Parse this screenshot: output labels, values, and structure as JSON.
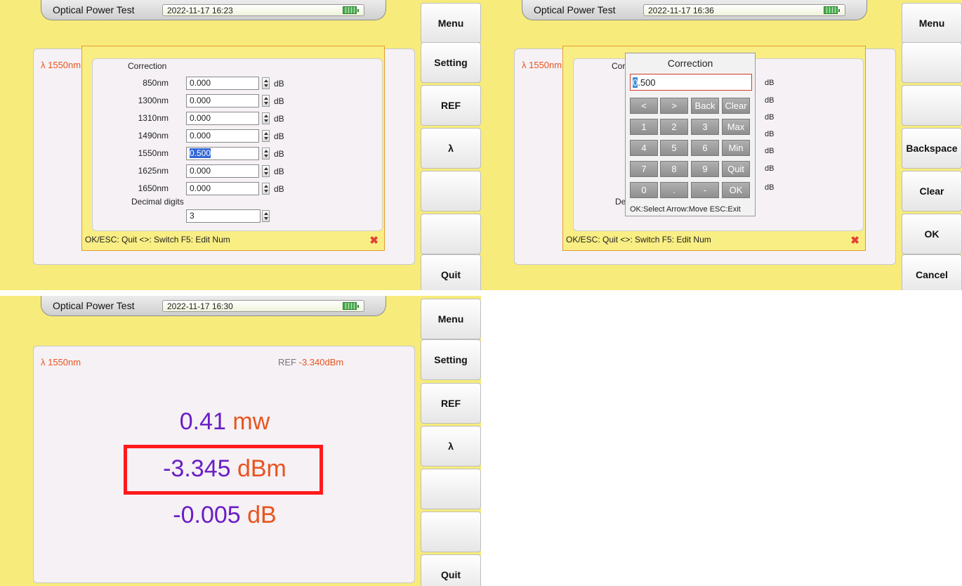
{
  "panel_correction": {
    "title": "Optical Power Test",
    "datetime": "2022-11-17 16:23",
    "wavelength": "λ 1550nm",
    "softkeys": [
      "Menu",
      "Setting",
      "REF",
      "λ",
      "",
      "",
      "Quit"
    ],
    "dialog": {
      "heading": "Correction",
      "rows": [
        {
          "label": "850nm",
          "value": "0.000",
          "unit": "dB"
        },
        {
          "label": "1300nm",
          "value": "0.000",
          "unit": "dB"
        },
        {
          "label": "1310nm",
          "value": "0.000",
          "unit": "dB"
        },
        {
          "label": "1490nm",
          "value": "0.000",
          "unit": "dB"
        },
        {
          "label": "1550nm",
          "value": "0.500",
          "unit": "dB"
        },
        {
          "label": "1625nm",
          "value": "0.000",
          "unit": "dB"
        },
        {
          "label": "1650nm",
          "value": "0.000",
          "unit": "dB"
        }
      ],
      "decimal_label": "Decimal digits",
      "decimal_value": "3",
      "hint": "OK/ESC: Quit  <>: Switch  F5: Edit Num"
    }
  },
  "panel_keypad": {
    "title": "Optical Power Test",
    "datetime": "2022-11-17 16:36",
    "wavelength": "λ 1550nm",
    "softkeys": [
      "Menu",
      "",
      "",
      "Backspace",
      "Clear",
      "OK",
      "Cancel"
    ],
    "partial_heading": "Cor",
    "partial_decimal": "De",
    "hint": "OK/ESC: Quit  <>: Switch  F5: Edit Num",
    "db_units": [
      "dB",
      "dB",
      "dB",
      "dB",
      "dB",
      "dB",
      "dB"
    ],
    "keypad": {
      "title": "Correction",
      "value_first": "0",
      "value_rest": ".500",
      "keys": [
        [
          "<",
          ">",
          "Back",
          "Clear"
        ],
        [
          "1",
          "2",
          "3",
          "Max"
        ],
        [
          "4",
          "5",
          "6",
          "Min"
        ],
        [
          "7",
          "8",
          "9",
          "Quit"
        ],
        [
          "0",
          ".",
          "-",
          "OK"
        ]
      ],
      "hint": "OK:Select Arrow:Move ESC:Exit"
    }
  },
  "panel_measure": {
    "title": "Optical Power Test",
    "datetime": "2022-11-17 16:30",
    "wavelength": "λ 1550nm",
    "ref_prefix": "REF ",
    "ref_value": "-3.340dBm",
    "softkeys": [
      "Menu",
      "Setting",
      "REF",
      "λ",
      "",
      "",
      "Quit"
    ],
    "power_mw": {
      "value": "0.41",
      "unit": "mw"
    },
    "power_dbm": {
      "value": "-3.345",
      "unit": "dBm"
    },
    "relative_db": {
      "value": "-0.005",
      "unit": "dB"
    }
  },
  "colors": {
    "panel_bg": "#f7ec7b",
    "value": "#6a1ec4",
    "unit": "#e8541e",
    "highlight": "#ff1a1a"
  }
}
